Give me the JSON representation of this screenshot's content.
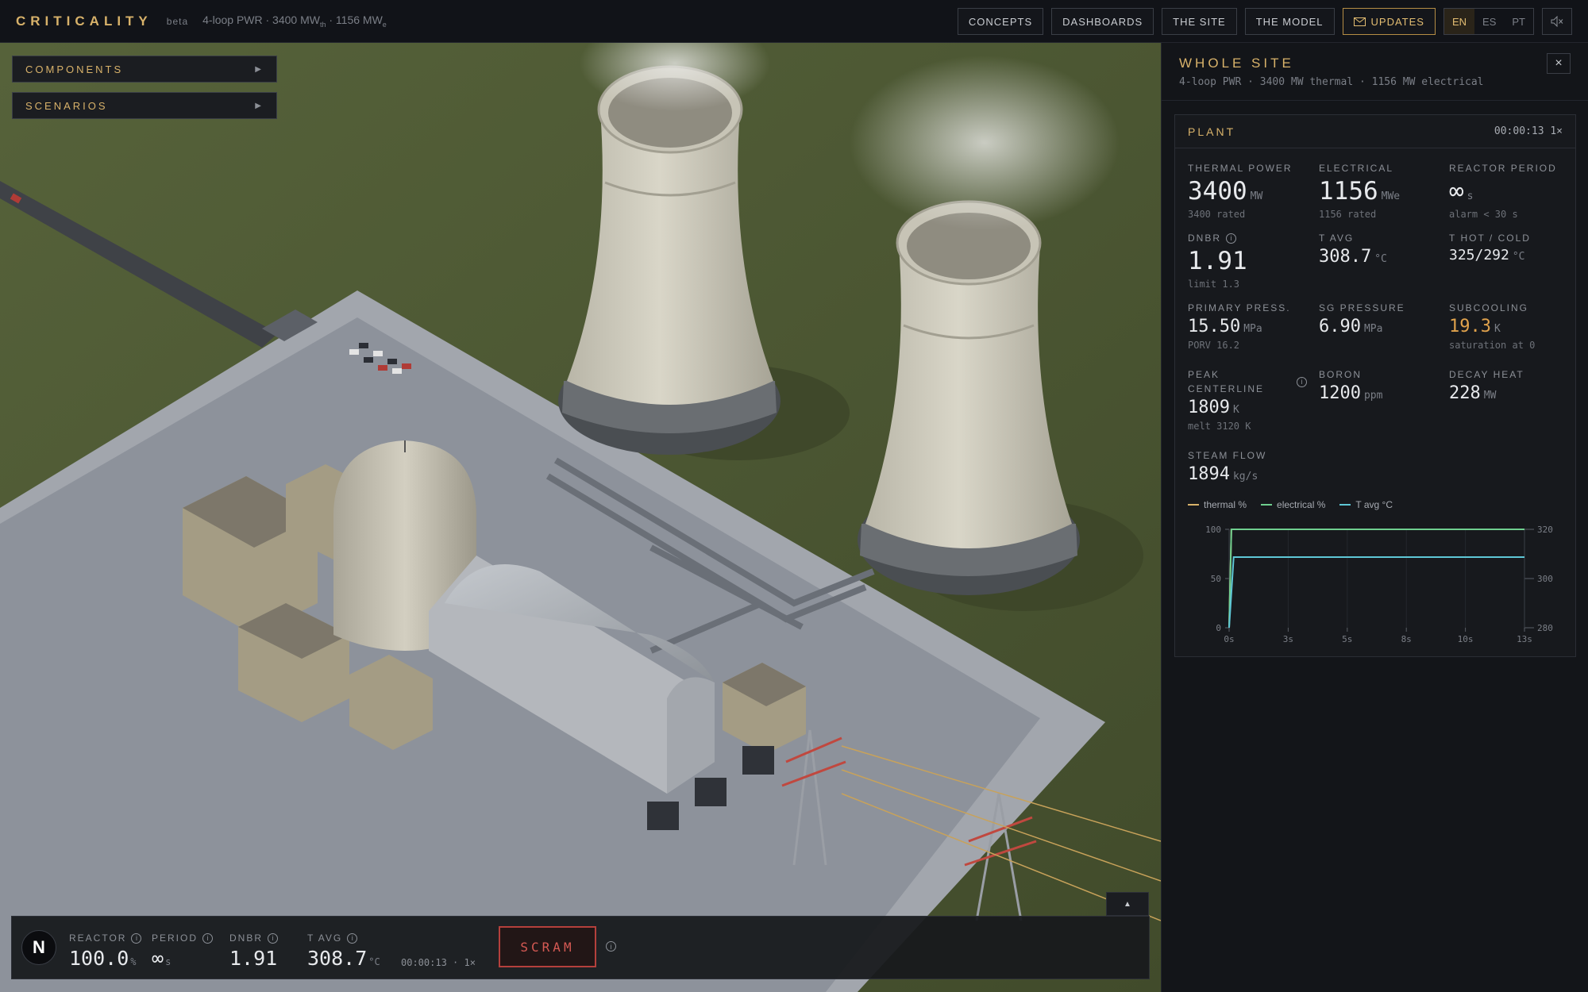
{
  "app": {
    "title": "CRITICALITY",
    "beta": "beta",
    "tagline_prefix": "4-loop PWR · 3400 MW",
    "tagline_sub1": "th",
    "tagline_mid": " · 1156 MW",
    "tagline_sub2": "e"
  },
  "nav": {
    "items": [
      "CONCEPTS",
      "DASHBOARDS",
      "THE SITE",
      "THE MODEL"
    ],
    "updates": "UPDATES",
    "languages": [
      "EN",
      "ES",
      "PT"
    ],
    "active_language": "EN"
  },
  "drawers": {
    "components": "COMPONENTS",
    "scenarios": "SCENARIOS"
  },
  "statusbar": {
    "logo": "N",
    "reactor": {
      "label": "REACTOR",
      "value": "100.0",
      "unit": "%"
    },
    "period": {
      "label": "PERIOD",
      "value": "∞",
      "unit": "s"
    },
    "dnbr": {
      "label": "DNBR",
      "value": "1.91"
    },
    "tavg": {
      "label": "T AVG",
      "value": "308.7",
      "unit": "°C"
    },
    "time": "00:00:13 · 1×",
    "scram": "SCRAM"
  },
  "panel": {
    "title": "WHOLE SITE",
    "subtitle": "4-loop PWR · 3400 MW thermal · 1156 MW electrical",
    "close": "×",
    "card": {
      "title": "PLANT",
      "time": "00:00:13 1×",
      "thermal": {
        "label": "THERMAL POWER",
        "value": "3400",
        "unit": "MW",
        "sub": "3400 rated"
      },
      "electrical": {
        "label": "ELECTRICAL",
        "value": "1156",
        "unit": "MWe",
        "sub": "1156 rated"
      },
      "period": {
        "label": "REACTOR PERIOD",
        "value": "∞",
        "unit": "s",
        "sub": "alarm < 30 s"
      },
      "dnbr": {
        "label": "DNBR",
        "value": "1.91",
        "sub": "limit 1.3"
      },
      "tavg": {
        "label": "T AVG",
        "value": "308.7",
        "unit": "°C"
      },
      "thotcold": {
        "label": "T HOT / COLD",
        "value": "325/292",
        "unit": "°C"
      },
      "primary": {
        "label": "PRIMARY PRESS.",
        "value": "15.50",
        "unit": "MPa",
        "sub": "PORV 16.2"
      },
      "sg": {
        "label": "SG PRESSURE",
        "value": "6.90",
        "unit": "MPa"
      },
      "subcooling": {
        "label": "SUBCOOLING",
        "value": "19.3",
        "unit": "K",
        "sub": "saturation at 0"
      },
      "peak": {
        "label": "PEAK CENTERLINE",
        "value": "1809",
        "unit": "K",
        "sub": "melt 3120 K"
      },
      "boron": {
        "label": "BORON",
        "value": "1200",
        "unit": "ppm"
      },
      "decay": {
        "label": "DECAY HEAT",
        "value": "228",
        "unit": "MW"
      },
      "steam": {
        "label": "STEAM FLOW",
        "value": "1894",
        "unit": "kg/s"
      }
    }
  },
  "colors": {
    "accent": "#d8b26a",
    "thermal": "#d8b26a",
    "electrical": "#6fcf8f",
    "tavg": "#5ec7d6",
    "warning": "#e0a24c",
    "scram": "#d65a54"
  },
  "chart_data": {
    "type": "line",
    "x_unit": "s",
    "x_ticks": [
      "0s",
      "3s",
      "5s",
      "8s",
      "10s",
      "13s"
    ],
    "x_tick_values": [
      0,
      2.6,
      5.2,
      7.8,
      10.4,
      13
    ],
    "xlim": [
      0,
      13
    ],
    "ylim_left": [
      0,
      100
    ],
    "y_ticks_left": [
      "0",
      "50",
      "100"
    ],
    "ylim_right": [
      280,
      320
    ],
    "y_ticks_right": [
      "280",
      "300",
      "320"
    ],
    "legend": [
      "thermal %",
      "electrical %",
      "T avg °C"
    ],
    "grid": true,
    "series": [
      {
        "name": "thermal %",
        "axis": "left",
        "x": [
          0,
          0.1,
          13
        ],
        "y": [
          0,
          100,
          100
        ]
      },
      {
        "name": "electrical %",
        "axis": "left",
        "x": [
          0,
          0.1,
          13
        ],
        "y": [
          0,
          100,
          100
        ]
      },
      {
        "name": "T avg °C",
        "axis": "right",
        "x": [
          0,
          0.2,
          13
        ],
        "y": [
          280,
          308.7,
          308.7
        ]
      }
    ]
  }
}
